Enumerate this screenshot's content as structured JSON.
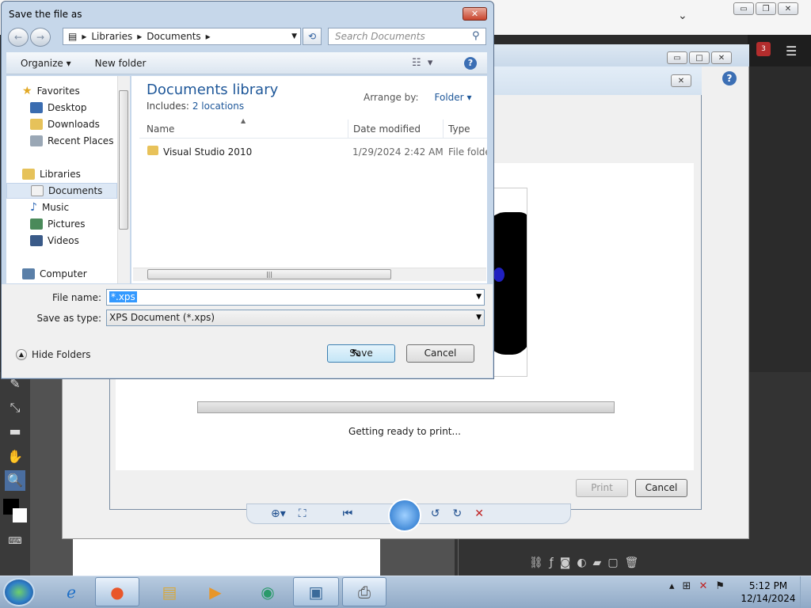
{
  "save_dialog": {
    "title": "Save the file as",
    "address": [
      "Libraries",
      "Documents"
    ],
    "search_placeholder": "Search Documents",
    "toolbar": {
      "organize": "Organize",
      "new_folder": "New folder"
    },
    "nav": {
      "favorites": "Favorites",
      "desktop": "Desktop",
      "downloads": "Downloads",
      "recent": "Recent Places",
      "libraries": "Libraries",
      "documents": "Documents",
      "music": "Music",
      "pictures": "Pictures",
      "videos": "Videos",
      "computer": "Computer"
    },
    "library_title": "Documents library",
    "includes_label": "Includes:",
    "includes_link": "2 locations",
    "arrange_label": "Arrange by:",
    "arrange_value": "Folder",
    "columns": {
      "name": "Name",
      "date": "Date modified",
      "type": "Type"
    },
    "files": [
      {
        "name": "Visual Studio 2010",
        "date": "1/29/2024 2:42 AM",
        "type": "File folder"
      }
    ],
    "file_name_label": "File name:",
    "file_name_value": "*.xps",
    "save_type_label": "Save as type:",
    "save_type_value": "XPS Document (*.xps)",
    "hide_folders": "Hide Folders",
    "save_button": "Save",
    "cancel_button": "Cancel"
  },
  "print_dialog": {
    "status": "Getting ready to print...",
    "print_button": "Print",
    "cancel_button": "Cancel"
  },
  "notification_badge": "3",
  "clock": {
    "time": "5:12 PM",
    "date": "12/14/2024"
  },
  "colors": {
    "accent": "#1e5799",
    "selection": "#3399ff",
    "close": "#c8442c"
  }
}
